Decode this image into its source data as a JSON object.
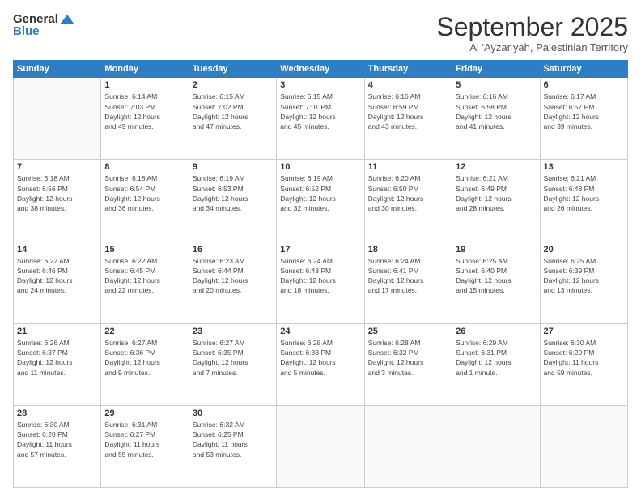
{
  "header": {
    "logo_general": "General",
    "logo_blue": "Blue",
    "month_title": "September 2025",
    "subtitle": "Al 'Ayzariyah, Palestinian Territory"
  },
  "days_of_week": [
    "Sunday",
    "Monday",
    "Tuesday",
    "Wednesday",
    "Thursday",
    "Friday",
    "Saturday"
  ],
  "weeks": [
    [
      {
        "day": "",
        "info": ""
      },
      {
        "day": "1",
        "info": "Sunrise: 6:14 AM\nSunset: 7:03 PM\nDaylight: 12 hours\nand 49 minutes."
      },
      {
        "day": "2",
        "info": "Sunrise: 6:15 AM\nSunset: 7:02 PM\nDaylight: 12 hours\nand 47 minutes."
      },
      {
        "day": "3",
        "info": "Sunrise: 6:15 AM\nSunset: 7:01 PM\nDaylight: 12 hours\nand 45 minutes."
      },
      {
        "day": "4",
        "info": "Sunrise: 6:16 AM\nSunset: 6:59 PM\nDaylight: 12 hours\nand 43 minutes."
      },
      {
        "day": "5",
        "info": "Sunrise: 6:16 AM\nSunset: 6:58 PM\nDaylight: 12 hours\nand 41 minutes."
      },
      {
        "day": "6",
        "info": "Sunrise: 6:17 AM\nSunset: 6:57 PM\nDaylight: 12 hours\nand 39 minutes."
      }
    ],
    [
      {
        "day": "7",
        "info": "Sunrise: 6:18 AM\nSunset: 6:56 PM\nDaylight: 12 hours\nand 38 minutes."
      },
      {
        "day": "8",
        "info": "Sunrise: 6:18 AM\nSunset: 6:54 PM\nDaylight: 12 hours\nand 36 minutes."
      },
      {
        "day": "9",
        "info": "Sunrise: 6:19 AM\nSunset: 6:53 PM\nDaylight: 12 hours\nand 34 minutes."
      },
      {
        "day": "10",
        "info": "Sunrise: 6:19 AM\nSunset: 6:52 PM\nDaylight: 12 hours\nand 32 minutes."
      },
      {
        "day": "11",
        "info": "Sunrise: 6:20 AM\nSunset: 6:50 PM\nDaylight: 12 hours\nand 30 minutes."
      },
      {
        "day": "12",
        "info": "Sunrise: 6:21 AM\nSunset: 6:49 PM\nDaylight: 12 hours\nand 28 minutes."
      },
      {
        "day": "13",
        "info": "Sunrise: 6:21 AM\nSunset: 6:48 PM\nDaylight: 12 hours\nand 26 minutes."
      }
    ],
    [
      {
        "day": "14",
        "info": "Sunrise: 6:22 AM\nSunset: 6:46 PM\nDaylight: 12 hours\nand 24 minutes."
      },
      {
        "day": "15",
        "info": "Sunrise: 6:22 AM\nSunset: 6:45 PM\nDaylight: 12 hours\nand 22 minutes."
      },
      {
        "day": "16",
        "info": "Sunrise: 6:23 AM\nSunset: 6:44 PM\nDaylight: 12 hours\nand 20 minutes."
      },
      {
        "day": "17",
        "info": "Sunrise: 6:24 AM\nSunset: 6:43 PM\nDaylight: 12 hours\nand 18 minutes."
      },
      {
        "day": "18",
        "info": "Sunrise: 6:24 AM\nSunset: 6:41 PM\nDaylight: 12 hours\nand 17 minutes."
      },
      {
        "day": "19",
        "info": "Sunrise: 6:25 AM\nSunset: 6:40 PM\nDaylight: 12 hours\nand 15 minutes."
      },
      {
        "day": "20",
        "info": "Sunrise: 6:25 AM\nSunset: 6:39 PM\nDaylight: 12 hours\nand 13 minutes."
      }
    ],
    [
      {
        "day": "21",
        "info": "Sunrise: 6:26 AM\nSunset: 6:37 PM\nDaylight: 12 hours\nand 11 minutes."
      },
      {
        "day": "22",
        "info": "Sunrise: 6:27 AM\nSunset: 6:36 PM\nDaylight: 12 hours\nand 9 minutes."
      },
      {
        "day": "23",
        "info": "Sunrise: 6:27 AM\nSunset: 6:35 PM\nDaylight: 12 hours\nand 7 minutes."
      },
      {
        "day": "24",
        "info": "Sunrise: 6:28 AM\nSunset: 6:33 PM\nDaylight: 12 hours\nand 5 minutes."
      },
      {
        "day": "25",
        "info": "Sunrise: 6:28 AM\nSunset: 6:32 PM\nDaylight: 12 hours\nand 3 minutes."
      },
      {
        "day": "26",
        "info": "Sunrise: 6:29 AM\nSunset: 6:31 PM\nDaylight: 12 hours\nand 1 minute."
      },
      {
        "day": "27",
        "info": "Sunrise: 6:30 AM\nSunset: 6:29 PM\nDaylight: 11 hours\nand 59 minutes."
      }
    ],
    [
      {
        "day": "28",
        "info": "Sunrise: 6:30 AM\nSunset: 6:28 PM\nDaylight: 11 hours\nand 57 minutes."
      },
      {
        "day": "29",
        "info": "Sunrise: 6:31 AM\nSunset: 6:27 PM\nDaylight: 11 hours\nand 55 minutes."
      },
      {
        "day": "30",
        "info": "Sunrise: 6:32 AM\nSunset: 6:25 PM\nDaylight: 11 hours\nand 53 minutes."
      },
      {
        "day": "",
        "info": ""
      },
      {
        "day": "",
        "info": ""
      },
      {
        "day": "",
        "info": ""
      },
      {
        "day": "",
        "info": ""
      }
    ]
  ]
}
